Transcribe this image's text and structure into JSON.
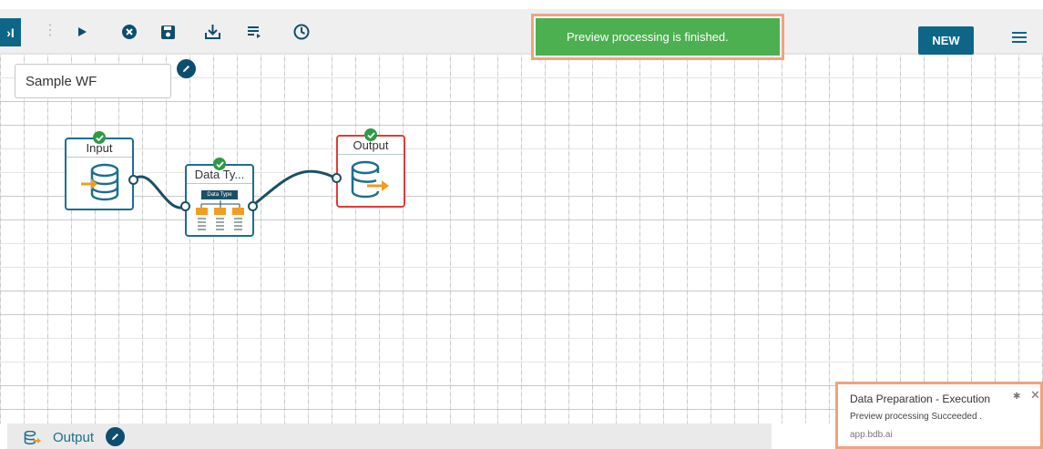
{
  "toolbar": {
    "collapse_label": "›I",
    "dots": "⋮",
    "icons": [
      "play-icon",
      "stop-icon",
      "save-icon",
      "download-icon",
      "list-run-icon",
      "history-icon"
    ],
    "new_label": "NEW"
  },
  "toast": {
    "message": "Preview processing is finished."
  },
  "workflow": {
    "name": "Sample WF"
  },
  "nodes": {
    "input": {
      "title": "Input"
    },
    "datatype": {
      "title": "Data Ty...",
      "inner_label": "Data Type"
    },
    "output": {
      "title": "Output"
    }
  },
  "notification": {
    "title": "Data Preparation - Execution",
    "body": "Preview processing Succeeded .",
    "source": "app.bdb.ai"
  },
  "bottom_panel": {
    "tab_label": "Output"
  },
  "colors": {
    "accent": "#0d6688",
    "success": "#4caf50",
    "error_border": "#e53935",
    "highlight": "#f0a37f",
    "orange_arrow": "#f39c1e"
  }
}
